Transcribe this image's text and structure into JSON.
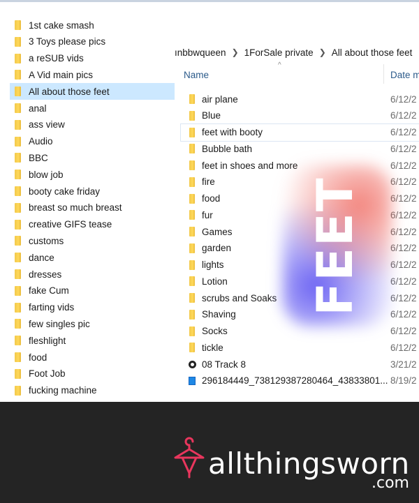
{
  "sidebar": {
    "items": [
      {
        "label": "1st cake smash"
      },
      {
        "label": "3 Toys please pics"
      },
      {
        "label": "a reSUB vids"
      },
      {
        "label": "A Vid main pics"
      },
      {
        "label": "All about those feet",
        "selected": true
      },
      {
        "label": "anal"
      },
      {
        "label": "ass view"
      },
      {
        "label": "Audio"
      },
      {
        "label": "BBC"
      },
      {
        "label": "blow job"
      },
      {
        "label": "booty cake friday"
      },
      {
        "label": "breast so much breast"
      },
      {
        "label": "creative GIFS tease"
      },
      {
        "label": "customs"
      },
      {
        "label": "dance"
      },
      {
        "label": "dresses"
      },
      {
        "label": "fake Cum"
      },
      {
        "label": "farting vids"
      },
      {
        "label": "few singles pic"
      },
      {
        "label": "fleshlight"
      },
      {
        "label": "food"
      },
      {
        "label": "Foot Job"
      },
      {
        "label": "fucking machine"
      }
    ]
  },
  "breadcrumb": {
    "items": [
      "ınbbwqueen",
      "1ForSale private",
      "All about those feet"
    ]
  },
  "columns": {
    "name": "Name",
    "date": "Date m"
  },
  "files": [
    {
      "name": "air plane",
      "date": "6/12/2",
      "type": "folder"
    },
    {
      "name": "Blue",
      "date": "6/12/2",
      "type": "folder"
    },
    {
      "name": "feet with booty",
      "date": "6/12/2",
      "type": "folder",
      "hover": true
    },
    {
      "name": "Bubble bath",
      "date": "6/12/2",
      "type": "folder"
    },
    {
      "name": "feet in shoes and more",
      "date": "6/12/2",
      "type": "folder"
    },
    {
      "name": "fire",
      "date": "6/12/2",
      "type": "folder"
    },
    {
      "name": "food",
      "date": "6/12/2",
      "type": "folder"
    },
    {
      "name": "fur",
      "date": "6/12/2",
      "type": "folder"
    },
    {
      "name": "Games",
      "date": "6/12/2",
      "type": "folder"
    },
    {
      "name": "garden",
      "date": "6/12/2",
      "type": "folder"
    },
    {
      "name": "lights",
      "date": "6/12/2",
      "type": "folder"
    },
    {
      "name": "Lotion",
      "date": "6/12/2",
      "type": "folder"
    },
    {
      "name": "scrubs and Soaks",
      "date": "6/12/2",
      "type": "folder"
    },
    {
      "name": "Shaving",
      "date": "6/12/2",
      "type": "folder"
    },
    {
      "name": "Socks",
      "date": "6/12/2",
      "type": "folder"
    },
    {
      "name": "tickle",
      "date": "6/12/2",
      "type": "folder"
    },
    {
      "name": "08 Track 8",
      "date": "3/21/2",
      "type": "media"
    },
    {
      "name": "296184449_738129387280464_43833801...",
      "date": "8/19/2",
      "type": "image"
    }
  ],
  "overlay": {
    "text": "FEET"
  },
  "footer": {
    "brand": "allthingsworn",
    "domain": ".com",
    "icon": "hanger-icon",
    "accent": "#e8365d"
  },
  "colors": {
    "selection": "#cce8ff",
    "folder": "#ffd95a",
    "footer_bg": "#242424"
  }
}
